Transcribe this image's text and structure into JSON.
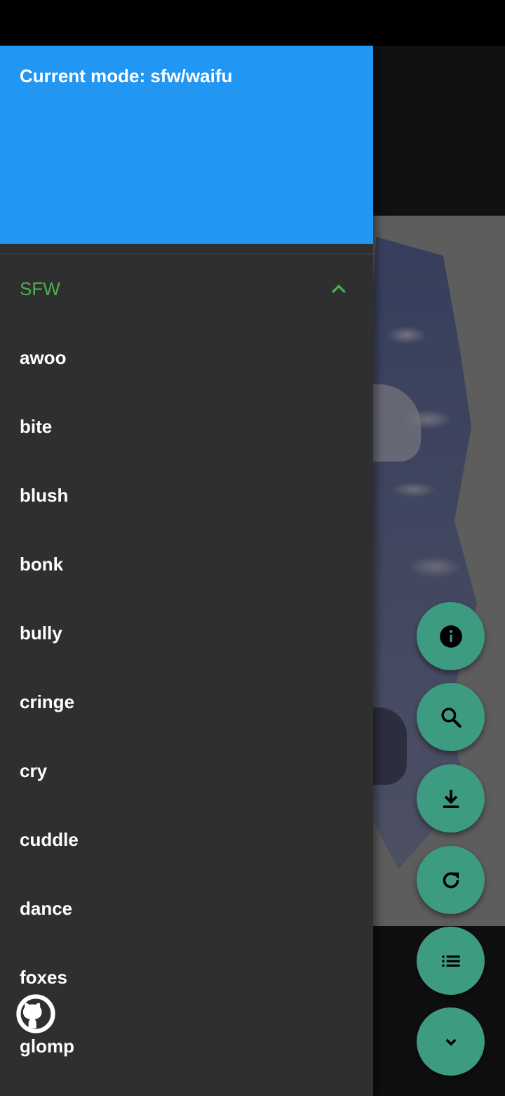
{
  "drawer": {
    "header_text": "Current mode: sfw/waifu",
    "section": {
      "label": "SFW",
      "expanded_icon": "chevron-up-icon"
    },
    "items": [
      {
        "label": "awoo"
      },
      {
        "label": "bite"
      },
      {
        "label": "blush"
      },
      {
        "label": "bonk"
      },
      {
        "label": "bully"
      },
      {
        "label": "cringe"
      },
      {
        "label": "cry"
      },
      {
        "label": "cuddle"
      },
      {
        "label": "dance"
      },
      {
        "label": "foxes"
      },
      {
        "label": "glomp"
      }
    ],
    "footer_icon": "github-icon"
  },
  "fabs": [
    {
      "icon": "info-icon"
    },
    {
      "icon": "search-icon"
    },
    {
      "icon": "download-icon"
    },
    {
      "icon": "refresh-icon"
    },
    {
      "icon": "list-icon"
    },
    {
      "icon": "chevron-down-icon"
    }
  ],
  "colors": {
    "header": "#2196f3",
    "drawer_bg": "#2f2f2f",
    "section_accent": "#4caf50",
    "fab": "#3d9b82"
  }
}
